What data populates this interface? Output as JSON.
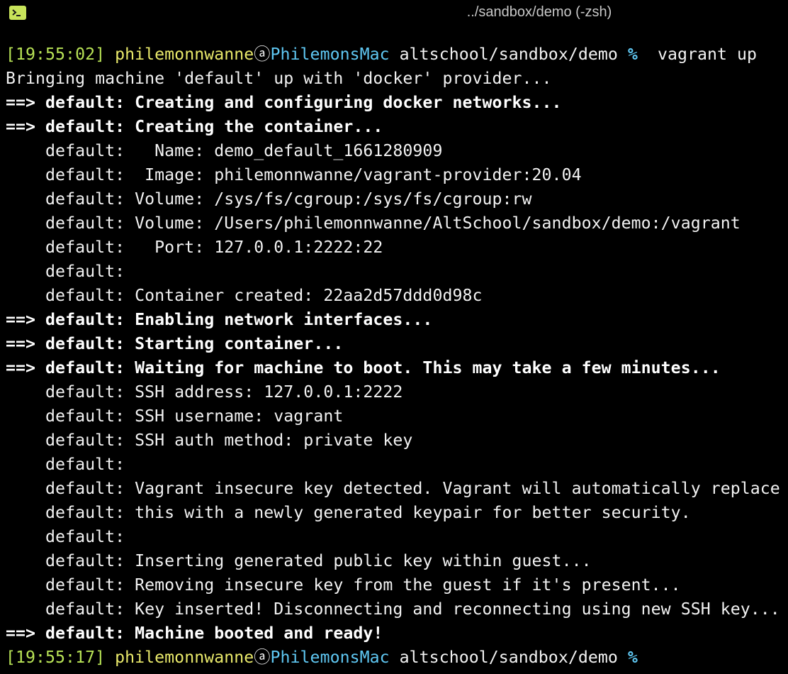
{
  "window": {
    "title": "../sandbox/demo (-zsh)",
    "icon": "terminal-icon"
  },
  "colors": {
    "background": "#000000",
    "text": "#f2f2f2",
    "timestamp": "#b8e356",
    "user": "#e8e86a",
    "host": "#5fc7f2",
    "icon_bg": "#c8e45a"
  },
  "prompt1": {
    "time": "[19:55:02]",
    "user": "philemonnwanne",
    "at": "ⓐ",
    "host": "PhilemonsMac",
    "path": "altschool/sandbox/demo",
    "symbol": "%",
    "command": "vagrant up"
  },
  "output": [
    {
      "arrow": "",
      "text": "Bringing machine 'default' up with 'docker' provider...",
      "bold": false
    },
    {
      "arrow": "==>",
      "text": "default: Creating and configuring docker networks...",
      "bold": true
    },
    {
      "arrow": "==>",
      "text": "default: Creating the container...",
      "bold": true
    },
    {
      "arrow": "   ",
      "text": "default:   Name: demo_default_1661280909",
      "bold": false
    },
    {
      "arrow": "   ",
      "text": "default:  Image: philemonnwanne/vagrant-provider:20.04",
      "bold": false
    },
    {
      "arrow": "   ",
      "text": "default: Volume: /sys/fs/cgroup:/sys/fs/cgroup:rw",
      "bold": false
    },
    {
      "arrow": "   ",
      "text": "default: Volume: /Users/philemonnwanne/AltSchool/sandbox/demo:/vagrant",
      "bold": false
    },
    {
      "arrow": "   ",
      "text": "default:   Port: 127.0.0.1:2222:22",
      "bold": false
    },
    {
      "arrow": "   ",
      "text": "default:",
      "bold": false
    },
    {
      "arrow": "   ",
      "text": "default: Container created: 22aa2d57ddd0d98c",
      "bold": false
    },
    {
      "arrow": "==>",
      "text": "default: Enabling network interfaces...",
      "bold": true
    },
    {
      "arrow": "==>",
      "text": "default: Starting container...",
      "bold": true
    },
    {
      "arrow": "==>",
      "text": "default: Waiting for machine to boot. This may take a few minutes...",
      "bold": true
    },
    {
      "arrow": "   ",
      "text": "default: SSH address: 127.0.0.1:2222",
      "bold": false
    },
    {
      "arrow": "   ",
      "text": "default: SSH username: vagrant",
      "bold": false
    },
    {
      "arrow": "   ",
      "text": "default: SSH auth method: private key",
      "bold": false
    },
    {
      "arrow": "   ",
      "text": "default:",
      "bold": false
    },
    {
      "arrow": "   ",
      "text": "default: Vagrant insecure key detected. Vagrant will automatically replace",
      "bold": false
    },
    {
      "arrow": "   ",
      "text": "default: this with a newly generated keypair for better security.",
      "bold": false
    },
    {
      "arrow": "   ",
      "text": "default:",
      "bold": false
    },
    {
      "arrow": "   ",
      "text": "default: Inserting generated public key within guest...",
      "bold": false
    },
    {
      "arrow": "   ",
      "text": "default: Removing insecure key from the guest if it's present...",
      "bold": false
    },
    {
      "arrow": "   ",
      "text": "default: Key inserted! Disconnecting and reconnecting using new SSH key...",
      "bold": false
    },
    {
      "arrow": "==>",
      "text": "default: Machine booted and ready!",
      "bold": true
    }
  ],
  "prompt2": {
    "time": "[19:55:17]",
    "user": "philemonnwanne",
    "at": "ⓐ",
    "host": "PhilemonsMac",
    "path": "altschool/sandbox/demo",
    "symbol": "%",
    "command": ""
  }
}
